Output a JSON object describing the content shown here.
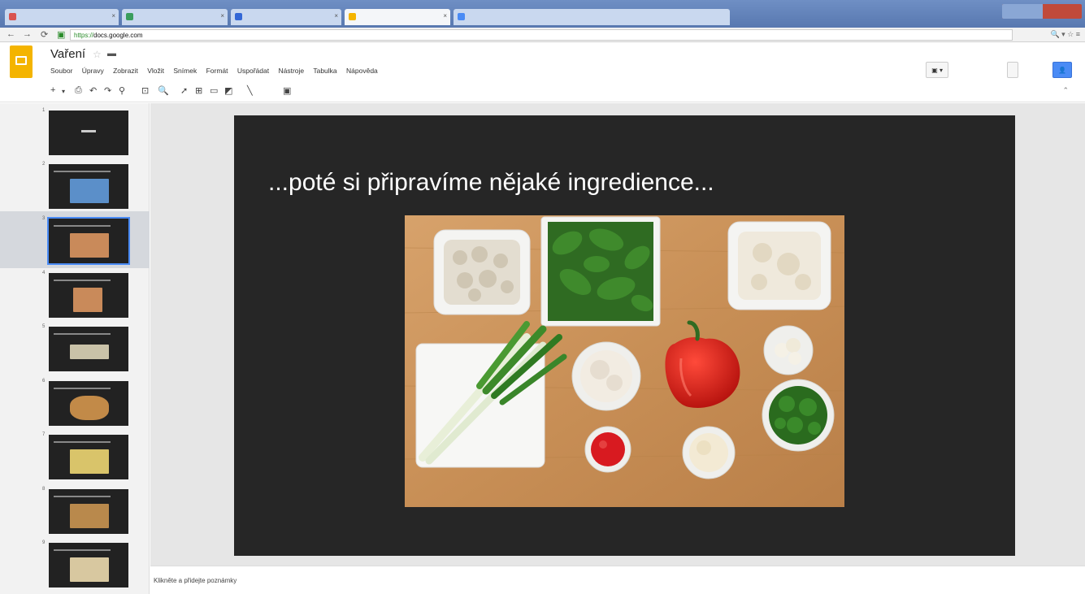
{
  "browser": {
    "tabs": [
      {
        "label": "",
        "color": "#d9534f"
      },
      {
        "label": "",
        "color": "#3a9d5d"
      },
      {
        "label": "",
        "color": "#3367d6"
      },
      {
        "label": "",
        "color": "#f4b400"
      },
      {
        "label": "",
        "color": "#4a8bf5"
      }
    ],
    "url": {
      "scheme": "https://",
      "host": "docs.google.com",
      "path": ""
    }
  },
  "app": {
    "title": "Vaření",
    "menu": [
      "Soubor",
      "Úpravy",
      "Zobrazit",
      "Vložit",
      "Snímek",
      "Formát",
      "Uspořádat",
      "Nástroje",
      "Tabulka",
      "Nápověda"
    ],
    "last_edit": "",
    "user_email": "",
    "present_label": "",
    "comments_label": "",
    "share_label": ""
  },
  "toolbar": {
    "text_buttons": [
      "",
      "",
      "",
      ""
    ]
  },
  "filmstrip": {
    "slides": [
      {
        "number": "1",
        "pic_color": "#262626"
      },
      {
        "number": "2",
        "pic_color": "#5b8fc9"
      },
      {
        "number": "3",
        "pic_color": "#c98a5a"
      },
      {
        "number": "4",
        "pic_color": "#c98a5a"
      },
      {
        "number": "5",
        "pic_color": "#c9c2a8"
      },
      {
        "number": "6",
        "pic_color": "#c28a48"
      },
      {
        "number": "7",
        "pic_color": "#d9c46a"
      },
      {
        "number": "8",
        "pic_color": "#b9894c"
      },
      {
        "number": "9",
        "pic_color": "#d8c8a0"
      }
    ],
    "selected_index": 2
  },
  "slide": {
    "title": "...poté si připravíme nějaké ingredience..."
  },
  "notes": {
    "placeholder": "Klikněte a přidejte poznámky"
  },
  "colors": {
    "accent": "#4a8bf5",
    "logo": "#f4b400",
    "slide_bg": "#262626",
    "board": "#c9915a"
  }
}
